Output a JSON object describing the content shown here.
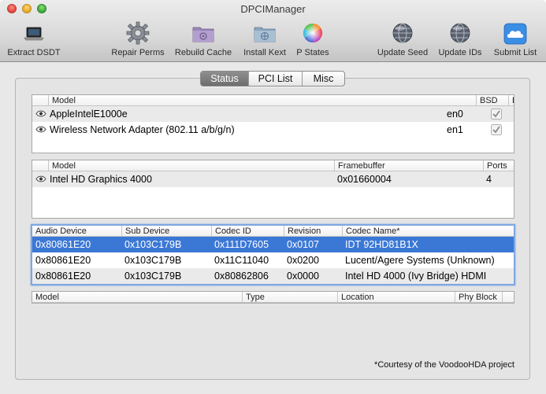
{
  "window": {
    "title": "DPCIManager"
  },
  "toolbar": {
    "extract_dsdt": "Extract DSDT",
    "repair_perms": "Repair Perms",
    "rebuild_cache": "Rebuild Cache",
    "install_kext": "Install Kext",
    "p_states": "P States",
    "update_seed": "Update Seed",
    "update_ids": "Update IDs",
    "submit_list": "Submit List"
  },
  "tabs": {
    "status": "Status",
    "pci_list": "PCI List",
    "misc": "Misc",
    "active": "Status"
  },
  "network_table": {
    "headers": {
      "model": "Model",
      "bsd": "BSD",
      "builtin": "Builtin"
    },
    "rows": [
      {
        "model": "AppleIntelE1000e",
        "bsd": "en0",
        "builtin": true
      },
      {
        "model": "Wireless Network Adapter (802.11 a/b/g/n)",
        "bsd": "en1",
        "builtin": true
      }
    ]
  },
  "graphics_table": {
    "headers": {
      "model": "Model",
      "framebuffer": "Framebuffer",
      "ports": "Ports"
    },
    "rows": [
      {
        "model": "Intel HD Graphics 4000",
        "framebuffer": "0x01660004",
        "ports": "4"
      }
    ]
  },
  "audio_table": {
    "headers": {
      "audio_device": "Audio Device",
      "sub_device": "Sub Device",
      "codec_id": "Codec ID",
      "revision": "Revision",
      "codec_name": "Codec Name*"
    },
    "rows": [
      {
        "audio_device": "0x80861E20",
        "sub_device": "0x103C179B",
        "codec_id": "0x111D7605",
        "revision": "0x0107",
        "codec_name": "IDT 92HD81B1X",
        "selected": true
      },
      {
        "audio_device": "0x80861E20",
        "sub_device": "0x103C179B",
        "codec_id": "0x11C11040",
        "revision": "0x0200",
        "codec_name": "Lucent/Agere Systems (Unknown)",
        "selected": false
      },
      {
        "audio_device": "0x80861E20",
        "sub_device": "0x103C179B",
        "codec_id": "0x80862806",
        "revision": "0x0000",
        "codec_name": "Intel HD 4000 (Ivy Bridge) HDMI",
        "selected": false
      }
    ]
  },
  "storage_table": {
    "headers": {
      "model": "Model",
      "type": "Type",
      "location": "Location",
      "phy_block": "Phy Block"
    },
    "rows": []
  },
  "footnote": "*Courtesy of the VoodooHDA project",
  "colors": {
    "selection": "#3b78d6",
    "stripe": "#eaeaea",
    "active_tab": "#7a7a7a"
  }
}
